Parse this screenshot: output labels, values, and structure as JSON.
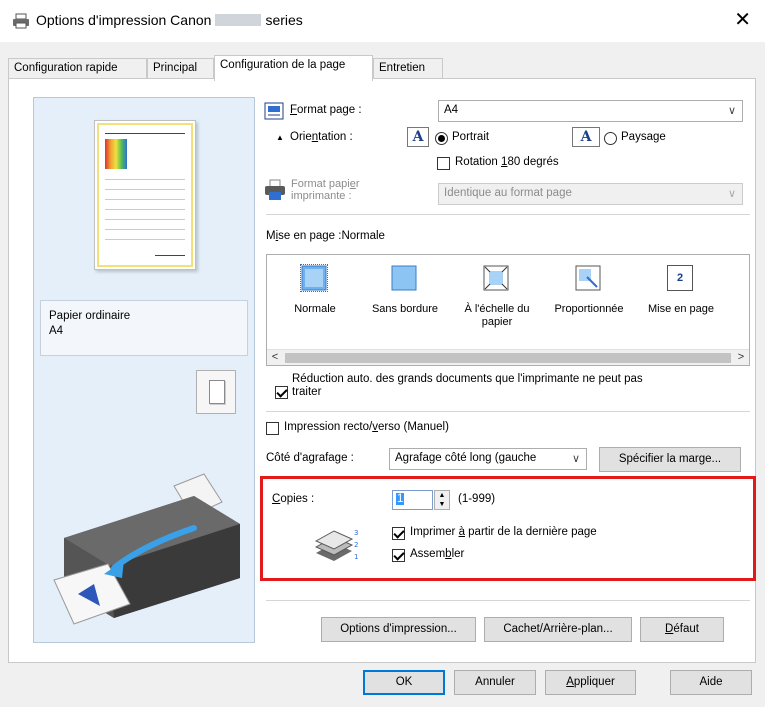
{
  "window": {
    "title_prefix": "Options d'impression Canon",
    "title_suffix": "series",
    "close_glyph": "✕"
  },
  "tabs": [
    "Configuration rapide",
    "Principal",
    "Configuration de la page",
    "Entretien"
  ],
  "active_tab_index": 2,
  "preview": {
    "paper_type": "Papier ordinaire",
    "paper_size": "A4"
  },
  "page_setup": {
    "format_label_u": "F",
    "format_label_rest": "ormat page :",
    "format_value": "A4",
    "orientation_label_a": "Orie",
    "orientation_label_u": "n",
    "orientation_label_b": "tation :",
    "orient_glyph": "A",
    "portrait_label": "Portrait",
    "landscape_label": "Paysage",
    "orientation_selected": "Portrait",
    "rotate_label_a": "Rotation ",
    "rotate_label_u": "1",
    "rotate_label_b": "80 degrés",
    "rotate_checked": false,
    "printer_paper_label_1": "Format papi",
    "printer_paper_label_u": "e",
    "printer_paper_label_1b": "r",
    "printer_paper_label_2": "imprimante :",
    "printer_paper_value": "Identique au format page",
    "printer_paper_enabled": false
  },
  "layout": {
    "header_a": "M",
    "header_u": "i",
    "header_b": "se en page :Normale",
    "items": [
      {
        "label": "Normale",
        "icon": "normal-layout-icon",
        "selected": true
      },
      {
        "label": "Sans bordure",
        "icon": "borderless-layout-icon",
        "selected": false
      },
      {
        "label": "À l'échelle du papier",
        "icon": "fit-to-paper-icon",
        "selected": false
      },
      {
        "label": "Proportionnée",
        "icon": "scaled-layout-icon",
        "selected": false
      },
      {
        "label": "Mise en page",
        "icon": "page-layout-icon",
        "selected": false,
        "badge": "2"
      }
    ],
    "scroll_left": "<",
    "scroll_right": ">"
  },
  "reduction": {
    "checked": true,
    "line1": "Réduction auto. des grands documents que l'imprimante ne peut pas",
    "line2": "traiter"
  },
  "duplex": {
    "checked": false,
    "label_a": "Impression recto/",
    "label_u": "v",
    "label_b": "erso (Manuel)"
  },
  "stapling": {
    "label": "Côté d'agrafage :",
    "value": "Agrafage côté long (gauche",
    "margin_button": "Spécifier la marge..."
  },
  "copies": {
    "label_u": "C",
    "label_rest": "opies :",
    "value": "1",
    "range": "(1-999)",
    "last_page": {
      "checked": true,
      "label_a": "Imprimer ",
      "label_u": "à",
      "label_b": " partir de la dernière page"
    },
    "collate": {
      "checked": true,
      "label_a": "Assem",
      "label_u": "b",
      "label_b": "ler"
    }
  },
  "bottom_buttons": {
    "print_options": "Options d'impression...",
    "stamp_background": "Cachet/Arrière-plan...",
    "default_u": "D",
    "default_rest": "éfaut"
  },
  "dialog_buttons": {
    "ok": "OK",
    "cancel": "Annuler",
    "apply_u": "A",
    "apply_rest": "ppliquer",
    "help": "Aide"
  },
  "colors": {
    "highlight_box": "#e11a1a",
    "preview_bg": "#e4effa",
    "accent": "#0078d7"
  }
}
